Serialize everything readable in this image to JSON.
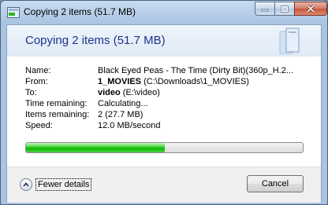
{
  "window": {
    "title": "Copying 2 items (51.7 MB)",
    "controls": {
      "minimize": "minimize-icon",
      "maximize": "maximize-icon",
      "close": "close-icon"
    }
  },
  "dialog": {
    "heading": "Copying 2 items (51.7 MB)",
    "details": {
      "name_label": "Name:",
      "name_value": "Black Eyed Peas - The Time (Dirty Bit)(360p_H.2...",
      "from_label": "From:",
      "from_bold": "1_MOVIES",
      "from_path": "(C:\\Downloads\\1_MOVIES)",
      "to_label": "To:",
      "to_bold": "video",
      "to_path": "(E:\\video)",
      "time_label": "Time remaining:",
      "time_value": "Calculating...",
      "items_label": "Items remaining:",
      "items_value": "2 (27.7 MB)",
      "speed_label": "Speed:",
      "speed_value": "12.0 MB/second"
    },
    "progress_fraction": 0.5
  },
  "footer": {
    "fewer_details_label": "Fewer details",
    "cancel_label": "Cancel"
  },
  "colors": {
    "heading": "#1e3287",
    "progress_green": "#14b00a"
  }
}
